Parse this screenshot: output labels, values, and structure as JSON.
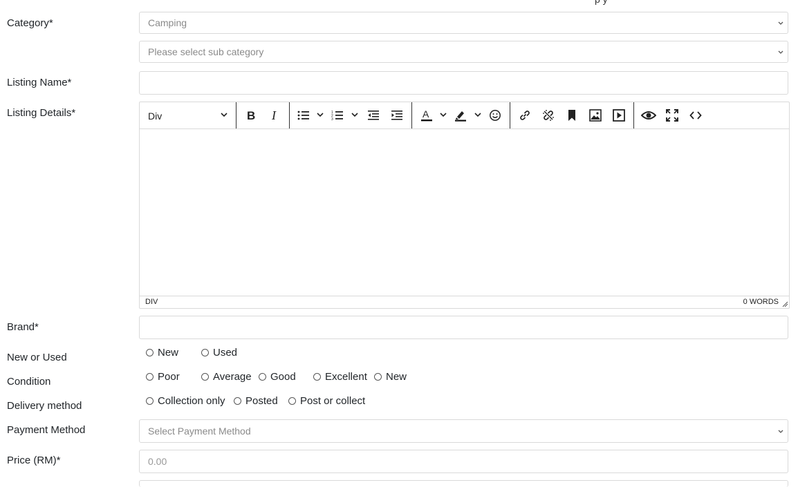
{
  "top_cutoff_text": "p           y",
  "form": {
    "category": {
      "label": "Category*",
      "value": "Camping"
    },
    "sub_category": {
      "placeholder": "Please select sub category"
    },
    "listing_name": {
      "label": "Listing Name*",
      "value": ""
    },
    "listing_details": {
      "label": "Listing Details*",
      "block_format": "Div",
      "status_path": "DIV",
      "word_count": "0 WORDS",
      "toolbar_icons": [
        "bold-icon",
        "italic-icon",
        "bullet-list-icon",
        "numbered-list-icon",
        "outdent-icon",
        "indent-icon",
        "text-color-icon",
        "highlight-icon",
        "emoji-icon",
        "link-icon",
        "unlink-icon",
        "bookmark-icon",
        "image-icon",
        "media-icon",
        "preview-icon",
        "fullscreen-icon",
        "code-icon"
      ]
    },
    "brand": {
      "label": "Brand*",
      "value": ""
    },
    "new_or_used": {
      "label": "New or Used",
      "options": [
        "New",
        "Used"
      ]
    },
    "condition": {
      "label": "Condition",
      "options": [
        "Poor",
        "Average",
        "Good",
        "Excellent",
        "New"
      ]
    },
    "delivery_method": {
      "label": "Delivery method",
      "options": [
        "Collection only",
        "Posted",
        "Post or collect"
      ]
    },
    "payment_method": {
      "label": "Payment Method",
      "placeholder": "Select Payment Method"
    },
    "price": {
      "label": "Price (RM)*",
      "placeholder": "0.00"
    }
  },
  "colors": {
    "border": "#d9d9d9",
    "placeholder": "#8a8a8a",
    "text": "#212529"
  }
}
